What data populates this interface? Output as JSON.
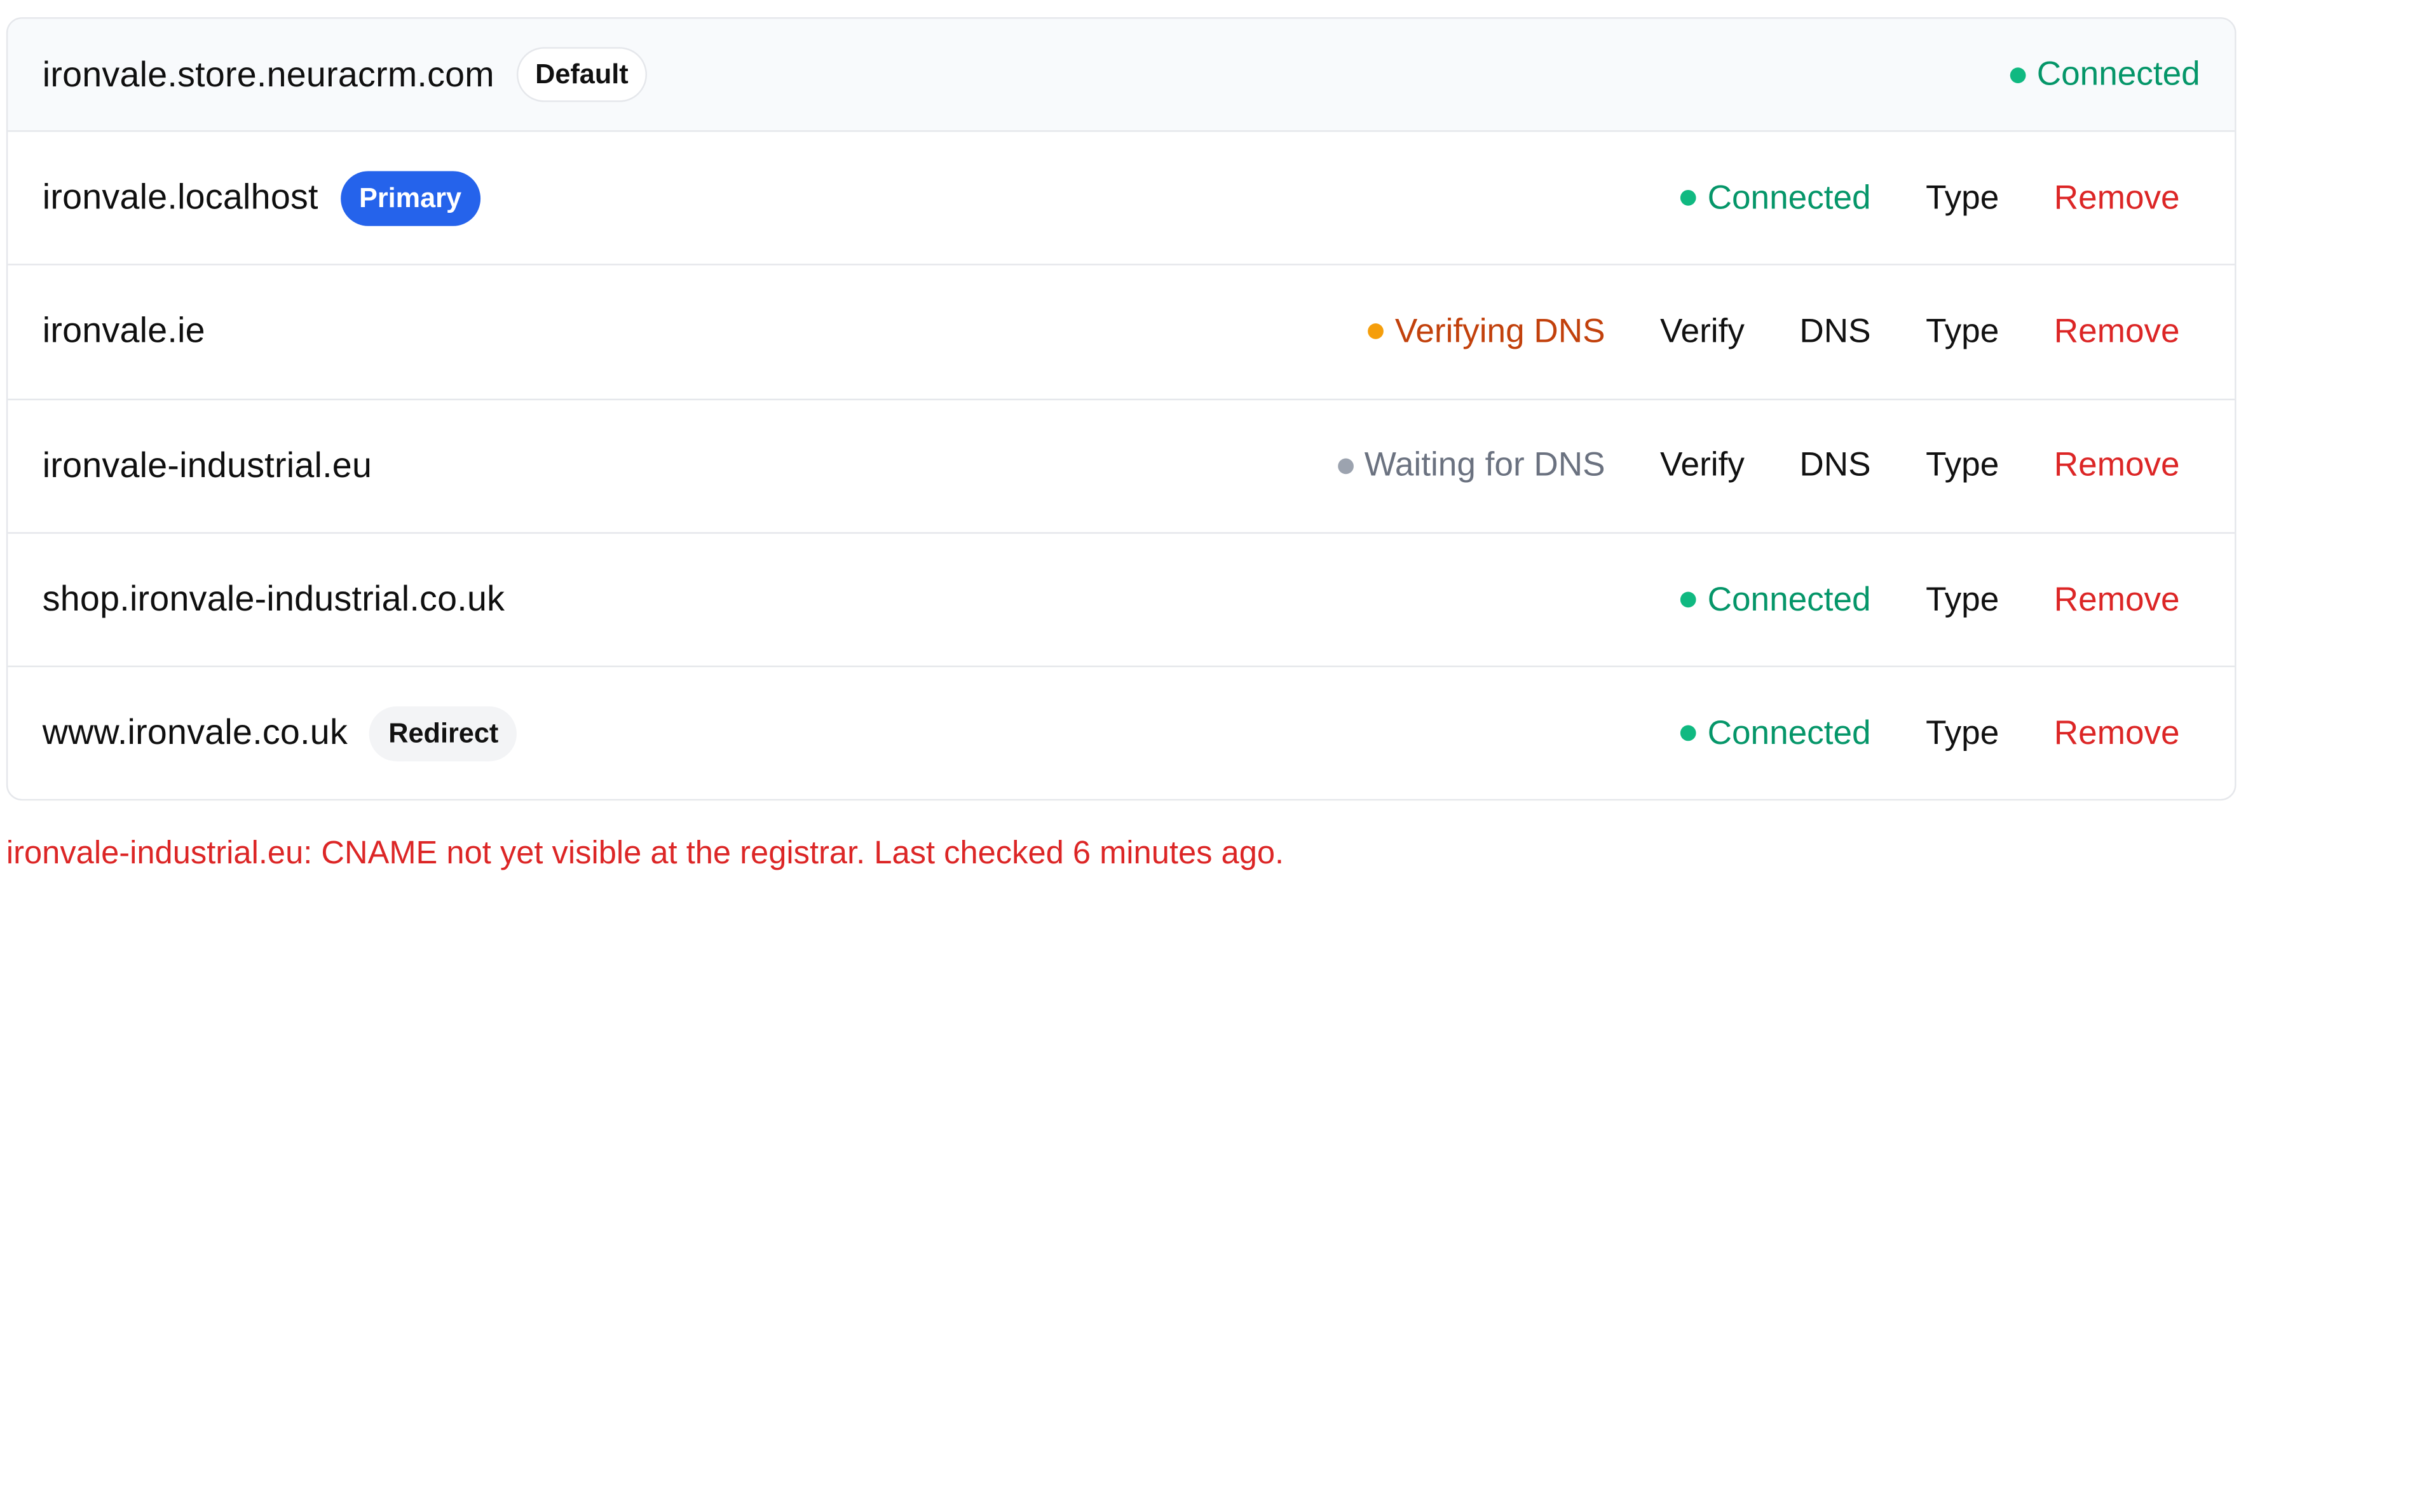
{
  "colors": {
    "connected": "#059669",
    "connected_dot": "#10b981",
    "verifying": "#c2410c",
    "verifying_dot": "#f59e0b",
    "waiting": "#6b7280",
    "waiting_dot": "#9ca3af",
    "remove": "#dc2626",
    "primary_badge": "#2563eb",
    "error": "#dc2626"
  },
  "domains": [
    {
      "name": "ironvale.store.neuracrm.com",
      "badge": "Default",
      "status": "Connected"
    },
    {
      "name": "ironvale.localhost",
      "badge": "Primary",
      "status": "Connected",
      "actions": {
        "type": "Type",
        "remove": "Remove"
      }
    },
    {
      "name": "ironvale.ie",
      "status": "Verifying DNS",
      "actions": {
        "verify": "Verify",
        "dns": "DNS",
        "type": "Type",
        "remove": "Remove"
      }
    },
    {
      "name": "ironvale-industrial.eu",
      "status": "Waiting for DNS",
      "actions": {
        "verify": "Verify",
        "dns": "DNS",
        "type": "Type",
        "remove": "Remove"
      }
    },
    {
      "name": "shop.ironvale-industrial.co.uk",
      "status": "Connected",
      "actions": {
        "type": "Type",
        "remove": "Remove"
      }
    },
    {
      "name": "www.ironvale.co.uk",
      "badge": "Redirect",
      "status": "Connected",
      "actions": {
        "type": "Type",
        "remove": "Remove"
      }
    }
  ],
  "error_message": "ironvale-industrial.eu: CNAME not yet visible at the registrar. Last checked 6 minutes ago."
}
